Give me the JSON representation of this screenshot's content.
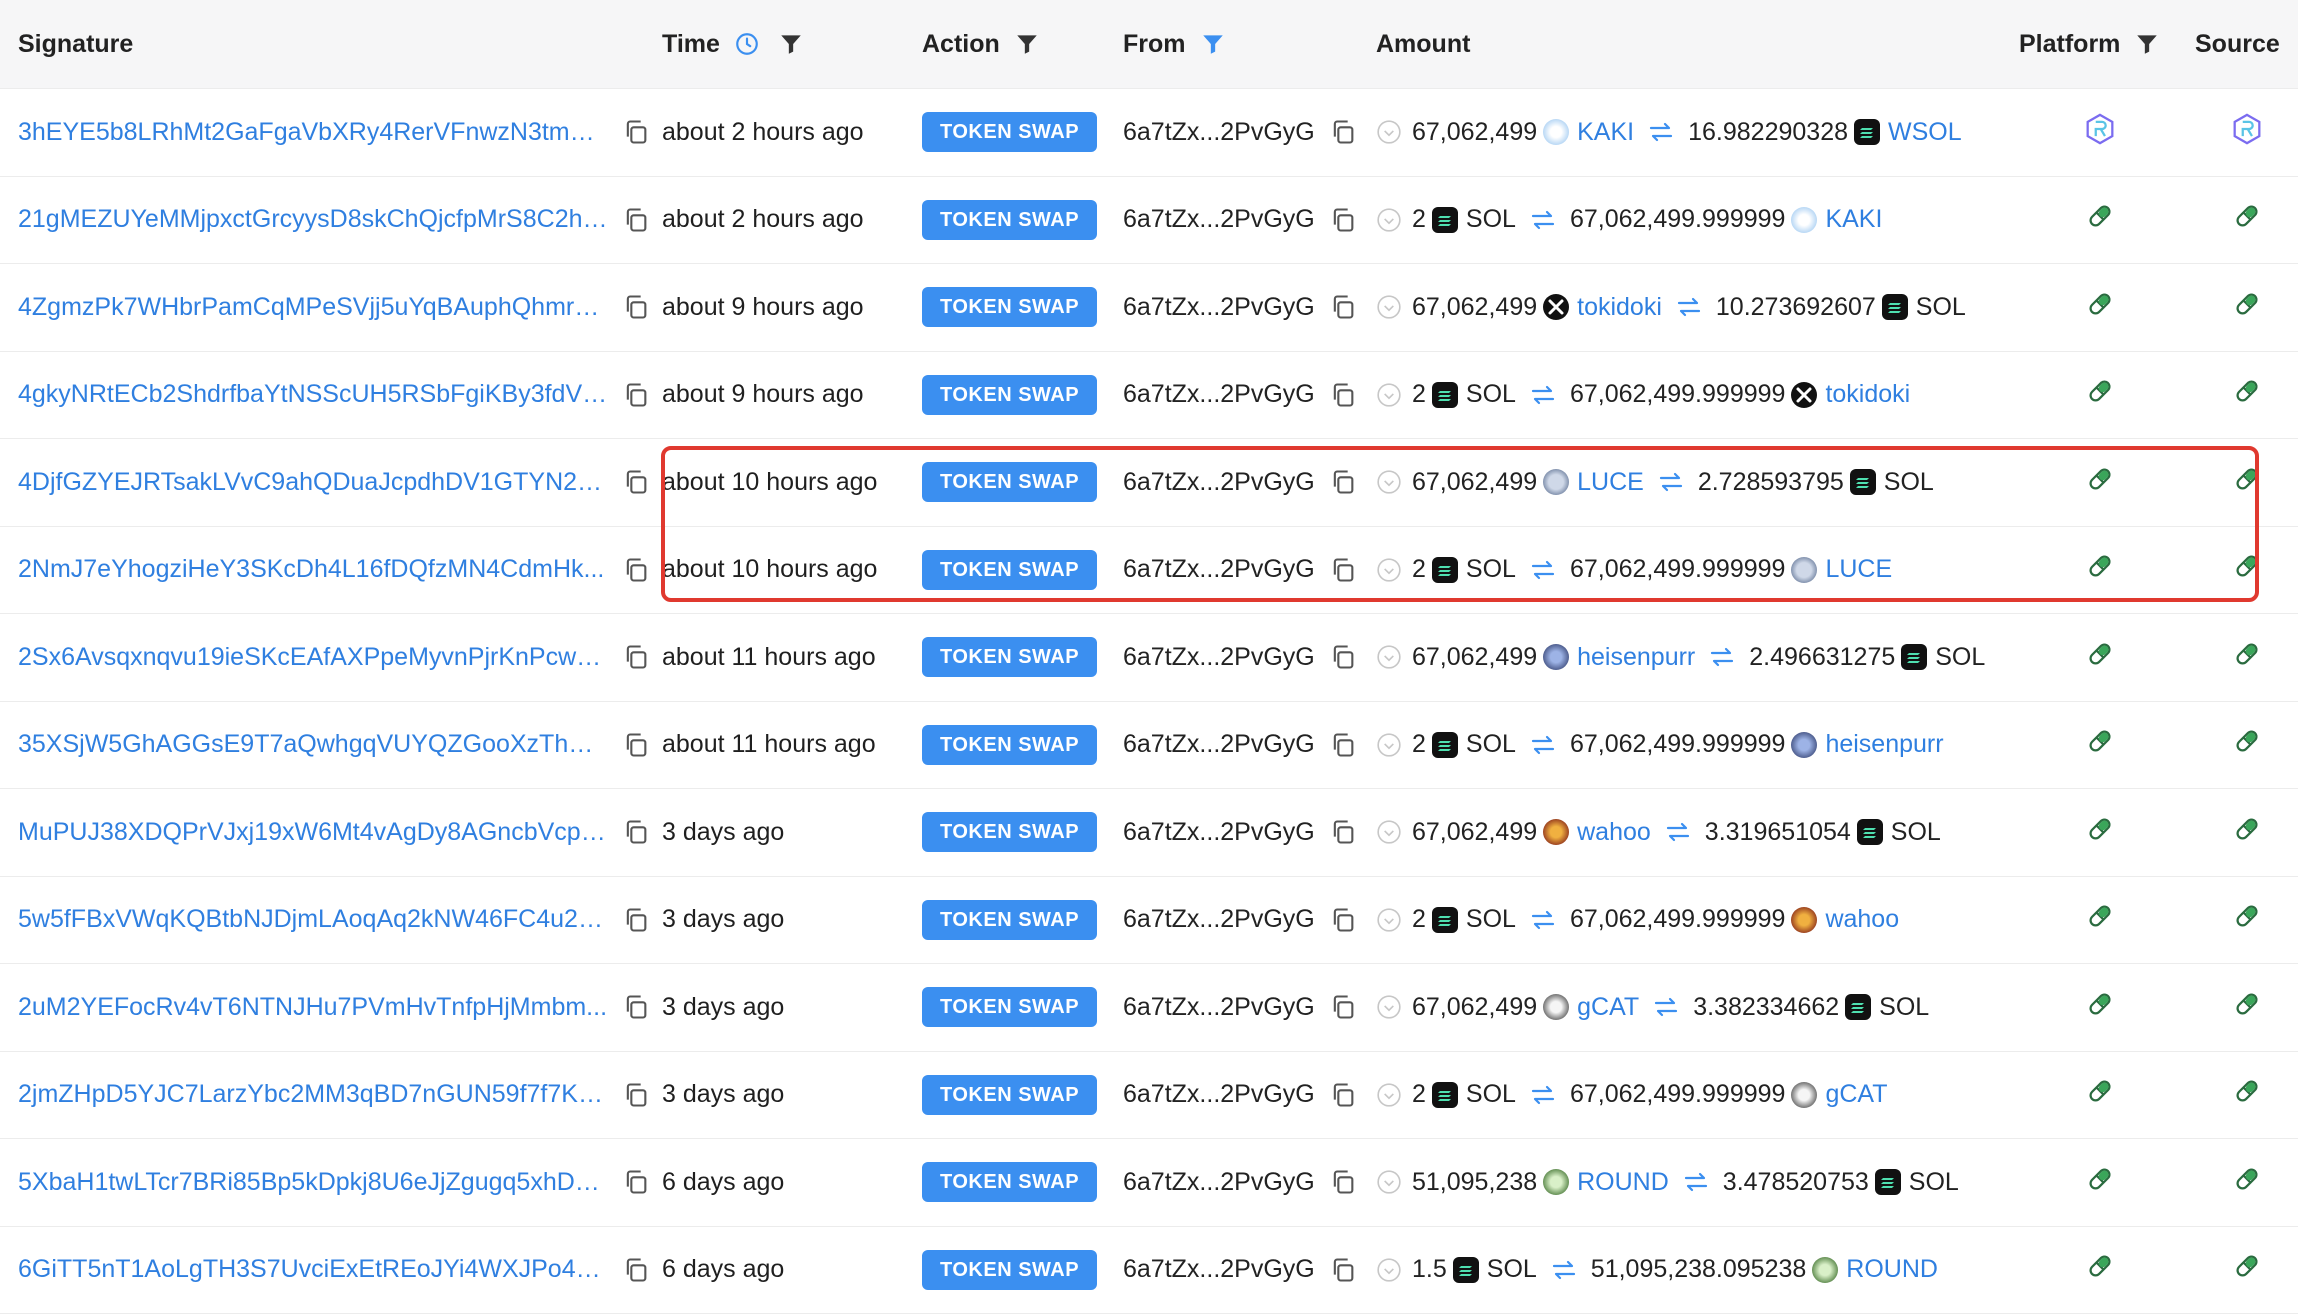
{
  "headers": {
    "signature": "Signature",
    "time": "Time",
    "action": "Action",
    "from": "From",
    "amount": "Amount",
    "platform": "Platform",
    "source": "Source"
  },
  "colors": {
    "link": "#2f7fe0",
    "badge": "#3b8ff0",
    "highlight": "#e0392f",
    "header_bg": "#f6f6f7"
  },
  "rows": [
    {
      "signature": "3hEYE5b8LRhMt2GaFgaVbXRy4RerVFnwzN3tmLt3...",
      "time": "about 2 hours ago",
      "action": "TOKEN SWAP",
      "from": "6a7tZx...2PvGyG",
      "in_amount": "67,062,499",
      "in_token": "KAKI",
      "in_icon": "kaki-token-icon",
      "out_amount": "16.982290328",
      "out_token": "WSOL",
      "out_icon": "sol-token-icon",
      "platform_icon": "raydium-icon",
      "source_icon": "raydium-icon"
    },
    {
      "signature": "21gMEZUYeMMjpxctGrcyysD8skChQjcfpMrS8C2h3...",
      "time": "about 2 hours ago",
      "action": "TOKEN SWAP",
      "from": "6a7tZx...2PvGyG",
      "in_amount": "2",
      "in_token": "SOL",
      "in_icon": "sol-token-icon",
      "out_amount": "67,062,499.999999",
      "out_token": "KAKI",
      "out_icon": "kaki-token-icon",
      "platform_icon": "pill-icon",
      "source_icon": "pill-icon"
    },
    {
      "signature": "4ZgmzPk7WHbrPamCqMPeSVjj5uYqBAuphQhmrb...",
      "time": "about 9 hours ago",
      "action": "TOKEN SWAP",
      "from": "6a7tZx...2PvGyG",
      "in_amount": "67,062,499",
      "in_token": "tokidoki",
      "in_icon": "tokidoki-token-icon",
      "out_amount": "10.273692607",
      "out_token": "SOL",
      "out_icon": "sol-token-icon",
      "platform_icon": "pill-icon",
      "source_icon": "pill-icon"
    },
    {
      "signature": "4gkyNRtECb2ShdrfbaYtNSScUH5RSbFgiKBy3fdVb...",
      "time": "about 9 hours ago",
      "action": "TOKEN SWAP",
      "from": "6a7tZx...2PvGyG",
      "in_amount": "2",
      "in_token": "SOL",
      "in_icon": "sol-token-icon",
      "out_amount": "67,062,499.999999",
      "out_token": "tokidoki",
      "out_icon": "tokidoki-token-icon",
      "platform_icon": "pill-icon",
      "source_icon": "pill-icon"
    },
    {
      "signature": "4DjfGZYEJRTsakLVvC9ahQDuaJcpdhDV1GTYN2fo...",
      "time": "about 10 hours ago",
      "action": "TOKEN SWAP",
      "from": "6a7tZx...2PvGyG",
      "in_amount": "67,062,499",
      "in_token": "LUCE",
      "in_icon": "luce-token-icon",
      "out_amount": "2.728593795",
      "out_token": "SOL",
      "out_icon": "sol-token-icon",
      "platform_icon": "pill-icon",
      "source_icon": "pill-icon"
    },
    {
      "signature": "2NmJ7eYhogziHeY3SKcDh4L16fDQfzMN4CdmHk...",
      "time": "about 10 hours ago",
      "action": "TOKEN SWAP",
      "from": "6a7tZx...2PvGyG",
      "in_amount": "2",
      "in_token": "SOL",
      "in_icon": "sol-token-icon",
      "out_amount": "67,062,499.999999",
      "out_token": "LUCE",
      "out_icon": "luce-token-icon",
      "platform_icon": "pill-icon",
      "source_icon": "pill-icon"
    },
    {
      "signature": "2Sx6Avsqxnqvu19ieSKcEAfAXPpeMyvnPjrKnPcw8...",
      "time": "about 11 hours ago",
      "action": "TOKEN SWAP",
      "from": "6a7tZx...2PvGyG",
      "in_amount": "67,062,499",
      "in_token": "heisenpurr",
      "in_icon": "heisenpurr-token-icon",
      "out_amount": "2.496631275",
      "out_token": "SOL",
      "out_icon": "sol-token-icon",
      "platform_icon": "pill-icon",
      "source_icon": "pill-icon"
    },
    {
      "signature": "35XSjW5GhAGGsE9T7aQwhgqVUYQZGooXzThHiH...",
      "time": "about 11 hours ago",
      "action": "TOKEN SWAP",
      "from": "6a7tZx...2PvGyG",
      "in_amount": "2",
      "in_token": "SOL",
      "in_icon": "sol-token-icon",
      "out_amount": "67,062,499.999999",
      "out_token": "heisenpurr",
      "out_icon": "heisenpurr-token-icon",
      "platform_icon": "pill-icon",
      "source_icon": "pill-icon"
    },
    {
      "signature": "MuPUJ38XDQPrVJxj19xW6Mt4vAgDy8AGncbVcpy...",
      "time": "3 days ago",
      "action": "TOKEN SWAP",
      "from": "6a7tZx...2PvGyG",
      "in_amount": "67,062,499",
      "in_token": "wahoo",
      "in_icon": "wahoo-token-icon",
      "out_amount": "3.319651054",
      "out_token": "SOL",
      "out_icon": "sol-token-icon",
      "platform_icon": "pill-icon",
      "source_icon": "pill-icon"
    },
    {
      "signature": "5w5fFBxVWqKQBtbNJDjmLAoqAq2kNW46FC4u2zi...",
      "time": "3 days ago",
      "action": "TOKEN SWAP",
      "from": "6a7tZx...2PvGyG",
      "in_amount": "2",
      "in_token": "SOL",
      "in_icon": "sol-token-icon",
      "out_amount": "67,062,499.999999",
      "out_token": "wahoo",
      "out_icon": "wahoo-token-icon",
      "platform_icon": "pill-icon",
      "source_icon": "pill-icon"
    },
    {
      "signature": "2uM2YEFocRv4vT6NTNJHu7PVmHvTnfpHjMmbm...",
      "time": "3 days ago",
      "action": "TOKEN SWAP",
      "from": "6a7tZx...2PvGyG",
      "in_amount": "67,062,499",
      "in_token": "gCAT",
      "in_icon": "gcat-token-icon",
      "out_amount": "3.382334662",
      "out_token": "SOL",
      "out_icon": "sol-token-icon",
      "platform_icon": "pill-icon",
      "source_icon": "pill-icon"
    },
    {
      "signature": "2jmZHpD5YJC7LarzYbc2MM3qBD7nGUN59f7f7Ko...",
      "time": "3 days ago",
      "action": "TOKEN SWAP",
      "from": "6a7tZx...2PvGyG",
      "in_amount": "2",
      "in_token": "SOL",
      "in_icon": "sol-token-icon",
      "out_amount": "67,062,499.999999",
      "out_token": "gCAT",
      "out_icon": "gcat-token-icon",
      "platform_icon": "pill-icon",
      "source_icon": "pill-icon"
    },
    {
      "signature": "5XbaH1twLTcr7BRi85Bp5kDpkj8U6eJjZgugq5xhDD...",
      "time": "6 days ago",
      "action": "TOKEN SWAP",
      "from": "6a7tZx...2PvGyG",
      "in_amount": "51,095,238",
      "in_token": "ROUND",
      "in_icon": "round-token-icon",
      "out_amount": "3.478520753",
      "out_token": "SOL",
      "out_icon": "sol-token-icon",
      "platform_icon": "pill-icon",
      "source_icon": "pill-icon"
    },
    {
      "signature": "6GiTT5nT1AoLgTH3S7UvciExEtREoJYi4WXJPo461...",
      "time": "6 days ago",
      "action": "TOKEN SWAP",
      "from": "6a7tZx...2PvGyG",
      "in_amount": "1.5",
      "in_token": "SOL",
      "in_icon": "sol-token-icon",
      "out_amount": "51,095,238.095238",
      "out_token": "ROUND",
      "out_icon": "round-token-icon",
      "platform_icon": "pill-icon",
      "source_icon": "pill-icon"
    }
  ]
}
